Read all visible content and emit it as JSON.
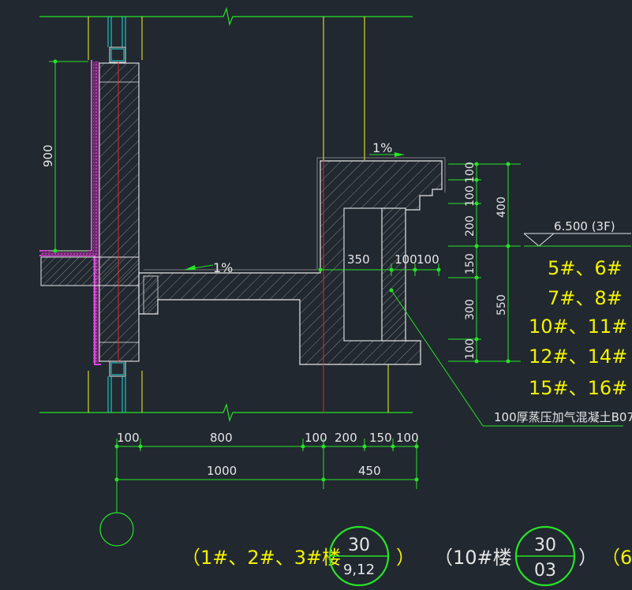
{
  "colors": {
    "background": "#212830",
    "green": "#27e327",
    "yellow": "#e5e52a",
    "white": "#e6e6e6",
    "red": "#e02a2a",
    "magenta": "#e14be1",
    "cyan": "#20dcdc",
    "text": "#e6e6e6",
    "label_yellow": "#f2f200"
  },
  "drawing": {
    "slope_labels": [
      "1%",
      "1%"
    ],
    "left_dim": "900",
    "right_dims_inner": [
      "100",
      "100",
      "200",
      "150",
      "300",
      "100"
    ],
    "right_dims_outer": [
      "400",
      "550"
    ],
    "elevation": "6.500 (3F)",
    "inner_dims": [
      "350",
      "100",
      "100"
    ],
    "building_lines": [
      "5#、6#",
      "7#、8#",
      "10#、11#",
      "12#、14#",
      "15#、16#"
    ],
    "material_note": "100厚蒸压加气混凝土B07",
    "bottom_dims_row1": [
      "100",
      "800",
      "100",
      "200",
      "150",
      "100"
    ],
    "bottom_dims_row2": [
      "1000",
      "450"
    ],
    "ref_group_1": {
      "prefix": "（1#、2#、3#楼",
      "top": "30",
      "bottom": "9,12",
      "suffix": "）"
    },
    "ref_group_2": {
      "prefix": "（10#楼",
      "top": "30",
      "bottom": "03",
      "suffix": "）"
    },
    "ref_group_3_prefix": "（6"
  }
}
